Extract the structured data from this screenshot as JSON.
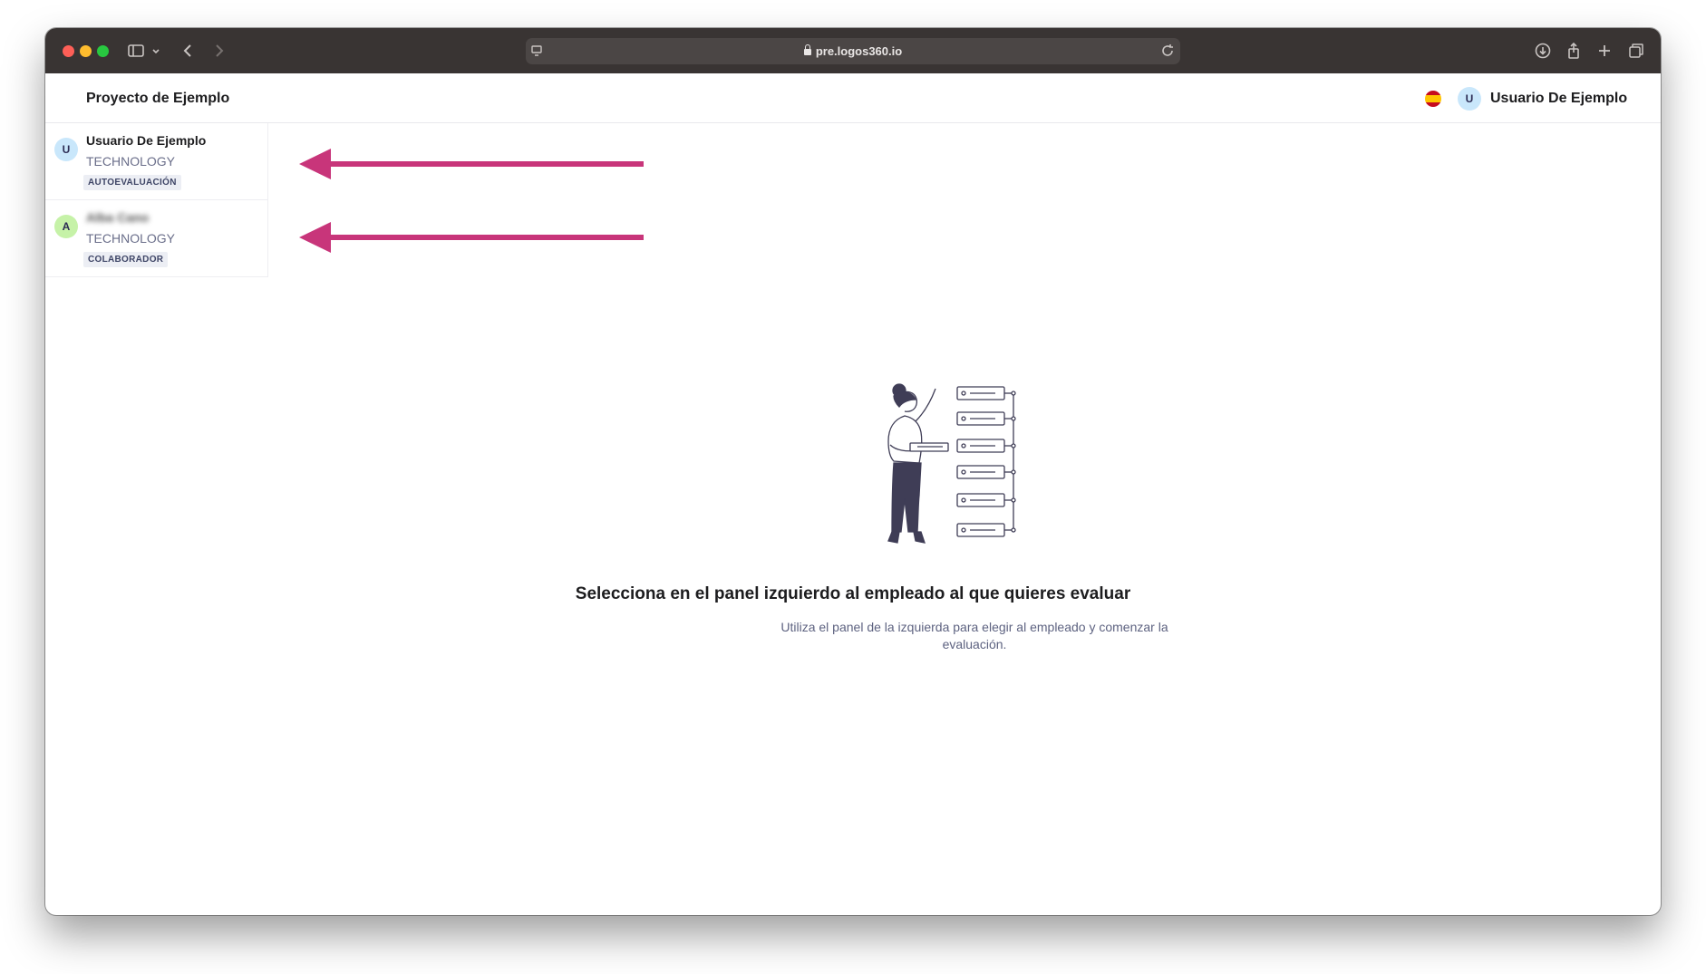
{
  "browser": {
    "url": "pre.logos360.io"
  },
  "header": {
    "project_title": "Proyecto de Ejemplo",
    "user_avatar": "U",
    "user_name": "Usuario De Ejemplo",
    "language_flag": "spain-flag"
  },
  "sidebar": {
    "items": [
      {
        "avatar": "U",
        "name": "Usuario De Ejemplo",
        "department": "TECHNOLOGY",
        "badge": "AUTOEVALUACIÓN",
        "avatar_color": "#c9e7fb"
      },
      {
        "avatar": "A",
        "name": "Alba Cano",
        "department": "TECHNOLOGY",
        "badge": "COLABORADOR",
        "avatar_color": "#c6f2a8"
      }
    ]
  },
  "empty_state": {
    "title": "Selecciona en el panel izquierdo al empleado al que quieres evaluar",
    "description": "Utiliza el panel de la izquierda para elegir al empleado y comenzar la evaluación."
  },
  "annotations": {
    "arrow_color": "#c8357a"
  }
}
